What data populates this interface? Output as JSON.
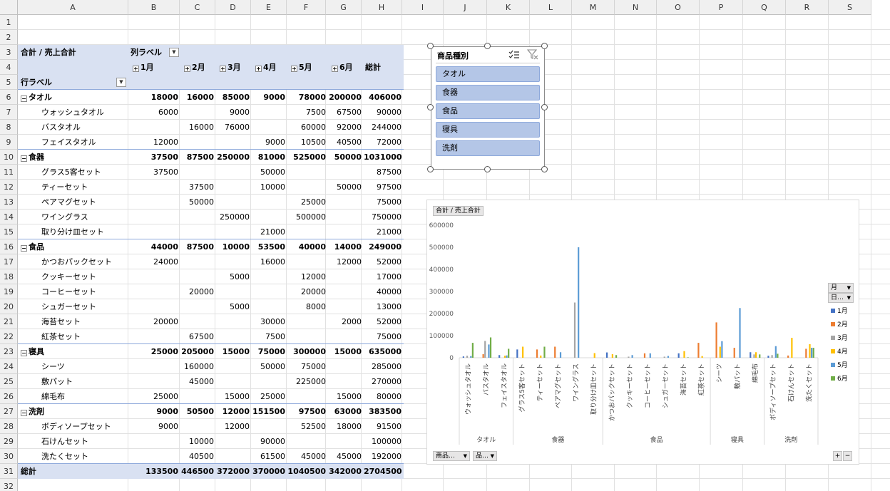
{
  "sheet": {
    "columns": [
      "A",
      "B",
      "C",
      "D",
      "E",
      "F",
      "G",
      "H",
      "I",
      "J",
      "K",
      "L",
      "M",
      "N",
      "O",
      "P",
      "Q",
      "R",
      "S"
    ],
    "rows": [
      "1",
      "2",
      "3",
      "4",
      "5",
      "6",
      "7",
      "8",
      "9",
      "10",
      "11",
      "12",
      "13",
      "14",
      "15",
      "16",
      "17",
      "18",
      "19",
      "20",
      "21",
      "22",
      "23",
      "24",
      "25",
      "26",
      "27",
      "28",
      "29",
      "30",
      "31",
      "32"
    ]
  },
  "pivot": {
    "value_label": "合計 / 売上合計",
    "column_labels": "列ラベル",
    "row_labels": "行ラベル",
    "months": [
      "1月",
      "2月",
      "3月",
      "4月",
      "5月",
      "6月"
    ],
    "total_header": "総計",
    "grand_total_label": "総計",
    "grand_total": [
      "133500",
      "446500",
      "372000",
      "370000",
      "1040500",
      "342000",
      "2704500"
    ],
    "categories": [
      {
        "name": "タオル",
        "totals": [
          "18000",
          "16000",
          "85000",
          "9000",
          "78000",
          "200000",
          "406000"
        ],
        "items": [
          {
            "name": "ウォッシュタオル",
            "values": [
              "6000",
              "",
              "9000",
              "",
              "7500",
              "67500",
              "90000"
            ]
          },
          {
            "name": "バスタオル",
            "values": [
              "",
              "16000",
              "76000",
              "",
              "60000",
              "92000",
              "244000"
            ]
          },
          {
            "name": "フェイスタオル",
            "values": [
              "12000",
              "",
              "",
              "9000",
              "10500",
              "40500",
              "72000"
            ]
          }
        ]
      },
      {
        "name": "食器",
        "totals": [
          "37500",
          "87500",
          "250000",
          "81000",
          "525000",
          "50000",
          "1031000"
        ],
        "items": [
          {
            "name": "グラス5客セット",
            "values": [
              "37500",
              "",
              "",
              "50000",
              "",
              "",
              "87500"
            ]
          },
          {
            "name": "ティーセット",
            "values": [
              "",
              "37500",
              "",
              "10000",
              "",
              "50000",
              "97500"
            ]
          },
          {
            "name": "ペアマグセット",
            "values": [
              "",
              "50000",
              "",
              "",
              "25000",
              "",
              "75000"
            ]
          },
          {
            "name": "ワイングラス",
            "values": [
              "",
              "",
              "250000",
              "",
              "500000",
              "",
              "750000"
            ]
          },
          {
            "name": "取り分け皿セット",
            "values": [
              "",
              "",
              "",
              "21000",
              "",
              "",
              "21000"
            ]
          }
        ]
      },
      {
        "name": "食品",
        "totals": [
          "44000",
          "87500",
          "10000",
          "53500",
          "40000",
          "14000",
          "249000"
        ],
        "items": [
          {
            "name": "かつおパックセット",
            "values": [
              "24000",
              "",
              "",
              "16000",
              "",
              "12000",
              "52000"
            ]
          },
          {
            "name": "クッキーセット",
            "values": [
              "",
              "",
              "5000",
              "",
              "12000",
              "",
              "17000"
            ]
          },
          {
            "name": "コーヒーセット",
            "values": [
              "",
              "20000",
              "",
              "",
              "20000",
              "",
              "40000"
            ]
          },
          {
            "name": "シュガーセット",
            "values": [
              "",
              "",
              "5000",
              "",
              "8000",
              "",
              "13000"
            ]
          },
          {
            "name": "海苔セット",
            "values": [
              "20000",
              "",
              "",
              "30000",
              "",
              "2000",
              "52000"
            ]
          },
          {
            "name": "紅茶セット",
            "values": [
              "",
              "67500",
              "",
              "7500",
              "",
              "",
              "75000"
            ]
          }
        ]
      },
      {
        "name": "寝具",
        "totals": [
          "25000",
          "205000",
          "15000",
          "75000",
          "300000",
          "15000",
          "635000"
        ],
        "items": [
          {
            "name": "シーツ",
            "values": [
              "",
              "160000",
              "",
              "50000",
              "75000",
              "",
              "285000"
            ]
          },
          {
            "name": "敷パット",
            "values": [
              "",
              "45000",
              "",
              "",
              "225000",
              "",
              "270000"
            ]
          },
          {
            "name": "綿毛布",
            "values": [
              "25000",
              "",
              "15000",
              "25000",
              "",
              "15000",
              "80000"
            ]
          }
        ]
      },
      {
        "name": "洗剤",
        "totals": [
          "9000",
          "50500",
          "12000",
          "151500",
          "97500",
          "63000",
          "383500"
        ],
        "items": [
          {
            "name": "ボディソープセット",
            "values": [
              "9000",
              "",
              "12000",
              "",
              "52500",
              "18000",
              "91500"
            ]
          },
          {
            "name": "石けんセット",
            "values": [
              "",
              "10000",
              "",
              "90000",
              "",
              "",
              "100000"
            ]
          },
          {
            "name": "洗たくセット",
            "values": [
              "",
              "40500",
              "",
              "61500",
              "45000",
              "45000",
              "192000"
            ]
          }
        ]
      }
    ]
  },
  "slicer": {
    "title": "商品種別",
    "items": [
      "タオル",
      "食器",
      "食品",
      "寝具",
      "洗剤"
    ],
    "multiselect_icon": "multi-select-icon",
    "clear_filter_icon": "clear-filter-icon"
  },
  "chart_data": {
    "type": "bar",
    "field_button_value": "合計 / 売上合計",
    "y_ticks": [
      "600000",
      "500000",
      "400000",
      "300000",
      "200000",
      "100000",
      "0"
    ],
    "ylim": [
      0,
      600000
    ],
    "legend_position": "right",
    "legend_field_buttons": [
      "月",
      "日…"
    ],
    "axis_field_buttons": [
      "商品…",
      "品…"
    ],
    "groups": [
      {
        "name": "タオル",
        "count": 3
      },
      {
        "name": "食器",
        "count": 5
      },
      {
        "name": "食品",
        "count": 6
      },
      {
        "name": "寝具",
        "count": 3
      },
      {
        "name": "洗剤",
        "count": 3
      }
    ],
    "categories": [
      "ウォッシュタオル",
      "バスタオル",
      "フェイスタオル",
      "グラス5客セット",
      "ティーセット",
      "ペアマグセット",
      "ワイングラス",
      "取り分け皿セット",
      "かつおパックセット",
      "クッキーセット",
      "コーヒーセット",
      "シュガーセット",
      "海苔セット",
      "紅茶セット",
      "シーツ",
      "敷パット",
      "綿毛布",
      "ボディソープセット",
      "石けんセット",
      "洗たくセット"
    ],
    "series": [
      {
        "name": "1月",
        "color": "#4472c4",
        "values": [
          6000,
          0,
          12000,
          37500,
          0,
          0,
          0,
          0,
          24000,
          0,
          0,
          0,
          20000,
          0,
          0,
          0,
          25000,
          9000,
          0,
          0
        ]
      },
      {
        "name": "2月",
        "color": "#ed7d31",
        "values": [
          0,
          16000,
          0,
          0,
          37500,
          50000,
          0,
          0,
          0,
          0,
          20000,
          0,
          0,
          67500,
          160000,
          45000,
          0,
          0,
          10000,
          40500
        ]
      },
      {
        "name": "3月",
        "color": "#a5a5a5",
        "values": [
          9000,
          76000,
          0,
          0,
          0,
          0,
          250000,
          0,
          0,
          5000,
          0,
          5000,
          0,
          0,
          0,
          0,
          15000,
          12000,
          0,
          0
        ]
      },
      {
        "name": "4月",
        "color": "#ffc000",
        "values": [
          0,
          0,
          9000,
          50000,
          10000,
          0,
          0,
          21000,
          16000,
          0,
          0,
          0,
          30000,
          7500,
          50000,
          0,
          25000,
          0,
          90000,
          61500
        ]
      },
      {
        "name": "5月",
        "color": "#5b9bd5",
        "values": [
          7500,
          60000,
          10500,
          0,
          0,
          25000,
          500000,
          0,
          0,
          12000,
          20000,
          8000,
          0,
          0,
          75000,
          225000,
          0,
          52500,
          0,
          45000
        ]
      },
      {
        "name": "6月",
        "color": "#70ad47",
        "values": [
          67500,
          92000,
          40500,
          0,
          50000,
          0,
          0,
          0,
          12000,
          0,
          0,
          0,
          2000,
          0,
          0,
          0,
          15000,
          18000,
          0,
          45000
        ]
      }
    ],
    "zoom_buttons": [
      "+",
      "−"
    ]
  }
}
